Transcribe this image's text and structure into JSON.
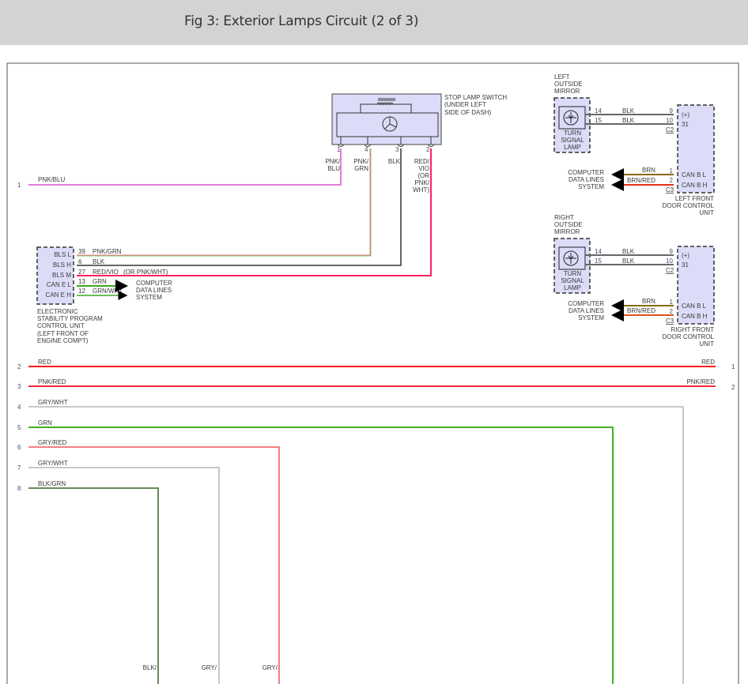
{
  "header": {
    "title": "Fig 3: Exterior Lamps Circuit (2 of 3)"
  },
  "colors": {
    "header_bg": "#d3d3d3",
    "component_fill": "#dcdcf8"
  },
  "stop_lamp_switch": {
    "label": [
      "STOP LAMP SWITCH",
      "(UNDER LEFT",
      "SIDE OF DASH)"
    ],
    "pins": [
      {
        "num": "1",
        "wire": [
          "PNK/",
          "BLU"
        ]
      },
      {
        "num": "4",
        "wire": [
          "PNK/",
          "GRN"
        ]
      },
      {
        "num": "3",
        "wire": [
          "BLK"
        ]
      },
      {
        "num": "2",
        "wire": [
          "RED/",
          "VIO",
          "(OR",
          "PNK/",
          "WHT)"
        ]
      }
    ]
  },
  "left_wire_1": {
    "num": "1",
    "color": "PNK/BLU"
  },
  "esp": {
    "label": [
      "ELECTRONIC",
      "STABILITY PROGRAM",
      "CONTROL UNIT",
      "(LEFT FRONT OF",
      "ENGINE COMPT)"
    ],
    "pins": [
      {
        "name": "BLS L",
        "num": "39",
        "wire": "PNK/GRN"
      },
      {
        "name": "BLS H",
        "num": "6",
        "wire": "BLK"
      },
      {
        "name": "BLS M",
        "num": "27",
        "wire": "RED/VIO",
        "alt": "(OR PNK/WHT)"
      },
      {
        "name": "CAN E L",
        "num": "13",
        "wire": "GRN"
      },
      {
        "name": "CAN E H",
        "num": "12",
        "wire": "GRN/WHT"
      }
    ],
    "dest": [
      "COMPUTER",
      "DATA LINES",
      "SYSTEM"
    ]
  },
  "left_mirror": {
    "label": [
      "LEFT",
      "OUTSIDE",
      "MIRROR"
    ],
    "lamp": [
      "TURN",
      "SIGNAL",
      "LAMP"
    ],
    "wires": [
      {
        "from": "14",
        "color": "BLK",
        "to": "9",
        "pin": "(+)"
      },
      {
        "from": "15",
        "color": "BLK",
        "to": "10",
        "pin": "31"
      }
    ],
    "c2": "C2",
    "can": [
      {
        "num": "1",
        "color": "BRN",
        "pin": "CAN B L"
      },
      {
        "num": "2",
        "color": "BRN/RED",
        "pin": "CAN B H"
      }
    ],
    "c3": "C3",
    "dest": [
      "COMPUTER",
      "DATA LINES",
      "SYSTEM"
    ],
    "unit": [
      "LEFT FRONT",
      "DOOR CONTROL",
      "UNIT"
    ]
  },
  "right_mirror": {
    "label": [
      "RIGHT",
      "OUTSIDE",
      "MIRROR"
    ],
    "lamp": [
      "TURN",
      "SIGNAL",
      "LAMP"
    ],
    "wires": [
      {
        "from": "14",
        "color": "BLK",
        "to": "9",
        "pin": "(+)"
      },
      {
        "from": "15",
        "color": "BLK",
        "to": "10",
        "pin": "31"
      }
    ],
    "c2": "C2",
    "can": [
      {
        "num": "1",
        "color": "BRN",
        "pin": "CAN B L"
      },
      {
        "num": "2",
        "color": "BRN/RED",
        "pin": "CAN B H"
      }
    ],
    "c3": "C3",
    "dest": [
      "COMPUTER",
      "DATA LINES",
      "SYSTEM"
    ],
    "unit": [
      "RIGHT FRONT",
      "DOOR CONTROL",
      "UNIT"
    ]
  },
  "bus_wires": [
    {
      "num": "2",
      "color": "RED",
      "right_color": "RED",
      "right_num": "1"
    },
    {
      "num": "3",
      "color": "PNK/RED",
      "right_color": "PNK/RED",
      "right_num": "2"
    },
    {
      "num": "4",
      "color": "GRY/WHT"
    },
    {
      "num": "5",
      "color": "GRN"
    },
    {
      "num": "6",
      "color": "GRY/RED"
    },
    {
      "num": "7",
      "color": "GRY/WHT"
    },
    {
      "num": "8",
      "color": "BLK/GRN"
    }
  ],
  "bottom_labels": [
    "BLK/",
    "GRY/",
    "GRY/"
  ]
}
